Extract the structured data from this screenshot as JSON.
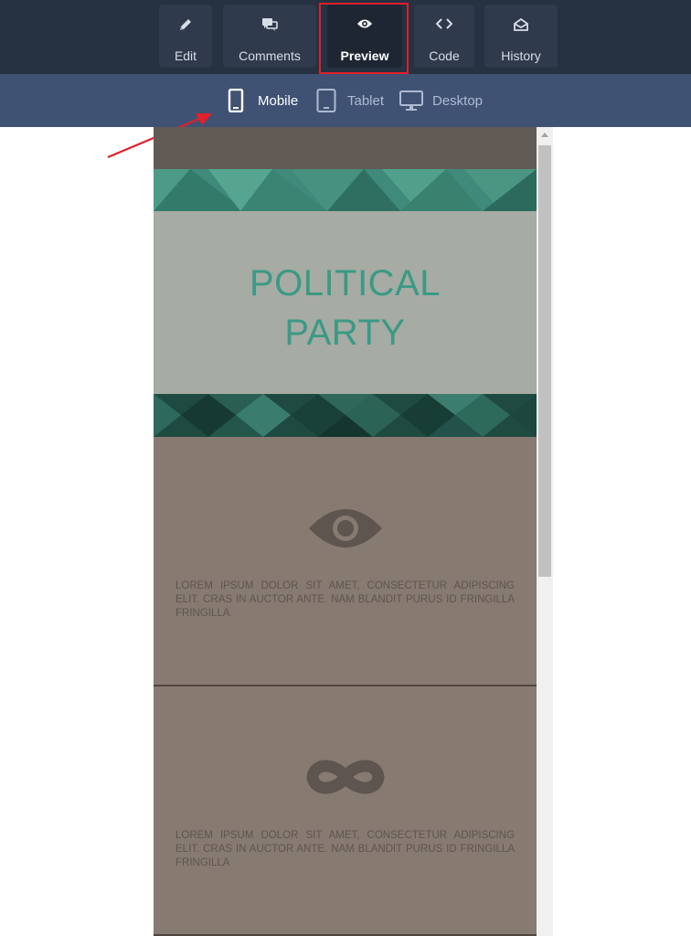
{
  "toolbar": {
    "items": [
      {
        "label": "Edit",
        "icon": "pencil-icon"
      },
      {
        "label": "Comments",
        "icon": "comments-icon"
      },
      {
        "label": "Preview",
        "icon": "eye-icon",
        "active": true
      },
      {
        "label": "Code",
        "icon": "code-icon"
      },
      {
        "label": "History",
        "icon": "envelope-open-icon"
      }
    ],
    "highlight_color": "#e0202a"
  },
  "devices": {
    "items": [
      {
        "label": "Mobile",
        "icon": "mobile-icon",
        "active": true
      },
      {
        "label": "Tablet",
        "icon": "tablet-icon"
      },
      {
        "label": "Desktop",
        "icon": "desktop-icon"
      }
    ]
  },
  "preview": {
    "hero": {
      "title_line1": "POLITICAL",
      "title_line2": "PARTY"
    },
    "features": [
      {
        "icon": "eye-icon",
        "text": "LOREM IPSUM DOLOR SIT AMET, CONSECTETUR ADIPISCING ELIT. CRAS IN AUCTOR ANTE. NAM BLANDIT PURUS ID FRINGILLA FRINGILLA"
      },
      {
        "icon": "infinity-icon",
        "text": "LOREM IPSUM DOLOR SIT AMET, CONSECTETUR ADIPISCING ELIT. CRAS IN AUCTOR ANTE. NAM BLANDIT PURUS ID FRINGILLA FRINGILLA"
      }
    ]
  },
  "colors": {
    "toolbar_bg": "#263142",
    "devicebar_bg": "#3f5274",
    "hero_bg": "#a6aba3",
    "hero_title": "#3a9a85",
    "feature_bg": "#877a70",
    "annotation_arrow": "#e0202a"
  }
}
